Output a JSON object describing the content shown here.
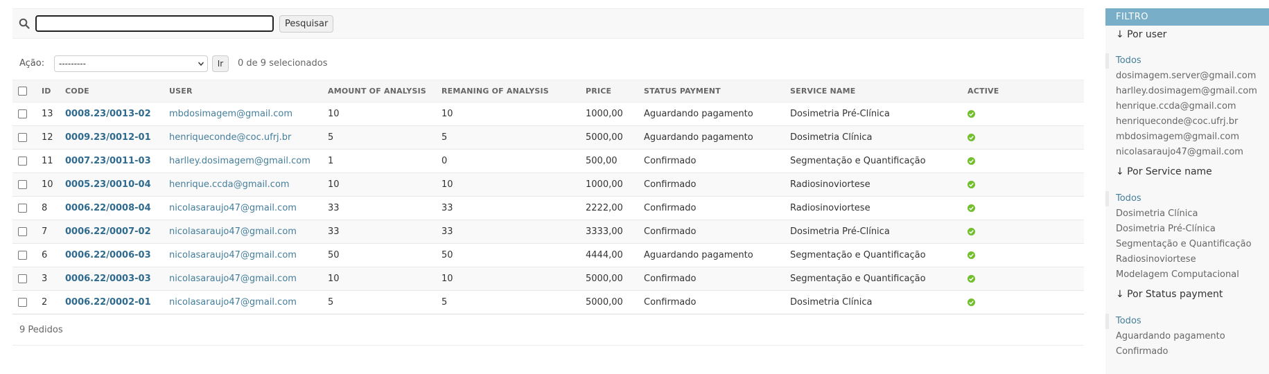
{
  "search": {
    "value": "",
    "button_label": "Pesquisar"
  },
  "actions": {
    "label": "Ação:",
    "selected_option": "---------",
    "go_label": "Ir",
    "counter": "0 de 9 selecionados"
  },
  "table": {
    "headers": {
      "id": "ID",
      "code": "CODE",
      "user": "USER",
      "amount": "AMOUNT OF ANALYSIS",
      "remaining": "REMANING OF ANALYSIS",
      "price": "PRICE",
      "status": "STATUS PAYMENT",
      "service": "SERVICE NAME",
      "active": "ACTIVE"
    },
    "rows": [
      {
        "id": "13",
        "code": "0008.23/0013-02",
        "user": "mbdosimagem@gmail.com",
        "amount": "10",
        "remaining": "10",
        "price": "1000,00",
        "status": "Aguardando pagamento",
        "service": "Dosimetria Pré-Clínica"
      },
      {
        "id": "12",
        "code": "0009.23/0012-01",
        "user": "henriqueconde@coc.ufrj.br",
        "amount": "5",
        "remaining": "5",
        "price": "5000,00",
        "status": "Aguardando pagamento",
        "service": "Dosimetria Clínica"
      },
      {
        "id": "11",
        "code": "0007.23/0011-03",
        "user": "harlley.dosimagem@gmail.com",
        "amount": "1",
        "remaining": "0",
        "price": "500,00",
        "status": "Confirmado",
        "service": "Segmentação e Quantificação"
      },
      {
        "id": "10",
        "code": "0005.23/0010-04",
        "user": "henrique.ccda@gmail.com",
        "amount": "10",
        "remaining": "10",
        "price": "1000,00",
        "status": "Confirmado",
        "service": "Radiosinoviortese"
      },
      {
        "id": "8",
        "code": "0006.22/0008-04",
        "user": "nicolasaraujo47@gmail.com",
        "amount": "33",
        "remaining": "33",
        "price": "2222,00",
        "status": "Confirmado",
        "service": "Radiosinoviortese"
      },
      {
        "id": "7",
        "code": "0006.22/0007-02",
        "user": "nicolasaraujo47@gmail.com",
        "amount": "33",
        "remaining": "33",
        "price": "3333,00",
        "status": "Confirmado",
        "service": "Dosimetria Pré-Clínica"
      },
      {
        "id": "6",
        "code": "0006.22/0006-03",
        "user": "nicolasaraujo47@gmail.com",
        "amount": "50",
        "remaining": "50",
        "price": "4444,00",
        "status": "Aguardando pagamento",
        "service": "Segmentação e Quantificação"
      },
      {
        "id": "3",
        "code": "0006.22/0003-03",
        "user": "nicolasaraujo47@gmail.com",
        "amount": "10",
        "remaining": "10",
        "price": "5000,00",
        "status": "Confirmado",
        "service": "Segmentação e Quantificação"
      },
      {
        "id": "2",
        "code": "0006.22/0002-01",
        "user": "nicolasaraujo47@gmail.com",
        "amount": "5",
        "remaining": "5",
        "price": "5000,00",
        "status": "Confirmado",
        "service": "Dosimetria Clínica"
      }
    ],
    "active_icon": "check-circle-icon",
    "active_color": "#70bf2b"
  },
  "paginator": {
    "text": "9 Pedidos"
  },
  "filter": {
    "title": "FILTRO",
    "sections": [
      {
        "heading": "↓ Por user",
        "items": [
          "Todos",
          "dosimagem.server@gmail.com",
          "harlley.dosimagem@gmail.com",
          "henrique.ccda@gmail.com",
          "henriqueconde@coc.ufrj.br",
          "mbdosimagem@gmail.com",
          "nicolasaraujo47@gmail.com"
        ]
      },
      {
        "heading": "↓ Por Service name",
        "items": [
          "Todos",
          "Dosimetria Clínica",
          "Dosimetria Pré-Clínica",
          "Segmentação e Quantificação",
          "Radiosinoviortese",
          "Modelagem Computacional"
        ]
      },
      {
        "heading": "↓ Por Status payment",
        "items": [
          "Todos",
          "Aguardando pagamento",
          "Confirmado"
        ]
      }
    ]
  },
  "colors": {
    "filter_header": "#79aec8",
    "link": "#447e9b"
  }
}
